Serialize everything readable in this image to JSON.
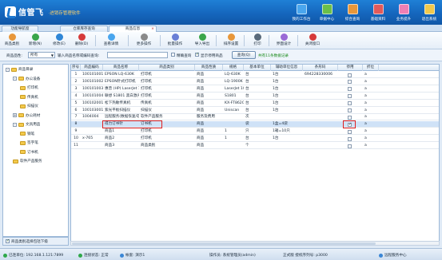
{
  "header": {
    "brand": "信管飞",
    "subtitle": "·进销存管理软件",
    "nav": [
      {
        "label": "我的工作台",
        "icon": "monitor-icon",
        "color": "#4aa6ee"
      },
      {
        "label": "单据中心",
        "icon": "document-icon",
        "color": "#6bbf4a"
      },
      {
        "label": "综合查询",
        "icon": "search-icon",
        "color": "#e8973a"
      },
      {
        "label": "基础资料",
        "icon": "database-icon",
        "color": "#e25a5a"
      },
      {
        "label": "业务提升",
        "icon": "chart-icon",
        "color": "#ef7fb4"
      },
      {
        "label": "退出系统",
        "icon": "exit-icon",
        "color": "#f2c94c"
      }
    ]
  },
  "tabs": [
    {
      "label": "功能导航窗"
    },
    {
      "label": "仓库库存查询"
    },
    {
      "label": "商品信息",
      "active": true
    }
  ],
  "toolbar": [
    {
      "label": "商品类别",
      "icon": "category-icon",
      "color": "#e8973a"
    },
    {
      "label": "新增(N)",
      "icon": "add-icon",
      "color": "#3aa64a"
    },
    {
      "label": "修改(E)",
      "icon": "edit-icon",
      "color": "#2f86d6"
    },
    {
      "label": "删除(D)",
      "icon": "delete-icon",
      "color": "#d63a3a"
    },
    {
      "label": "查看详情",
      "icon": "view-icon",
      "color": "#4aa6ee"
    },
    {
      "label": "更多操作",
      "icon": "more-icon",
      "color": "#8a8a8a"
    },
    {
      "label": "批量操作",
      "icon": "batch-icon",
      "color": "#6a7fd6"
    },
    {
      "label": "导入导出",
      "icon": "import-export-icon",
      "color": "#3aa64a"
    },
    {
      "label": "排序设置",
      "icon": "sort-icon",
      "color": "#e8973a"
    },
    {
      "label": "打印",
      "icon": "print-icon",
      "color": "#5a6a7a"
    },
    {
      "label": "界面设计",
      "icon": "design-icon",
      "color": "#9a6ad6"
    },
    {
      "label": "关闭窗口",
      "icon": "close-window-icon",
      "color": "#d63a3a"
    }
  ],
  "filter": {
    "type_label": "商品品性:",
    "type_value": "所有",
    "search_label": "输入商品名称或编码查询:",
    "opt_precise": "精确查询",
    "opt_show_disabled": "显示停用商品",
    "query_button": "查询(Q)",
    "count_text": "共有11条数据记录"
  },
  "tree": [
    {
      "label": "商品目录",
      "level": 0,
      "expander": "-"
    },
    {
      "label": "办公设备",
      "level": 1,
      "expander": "-"
    },
    {
      "label": "打印机",
      "level": 2
    },
    {
      "label": "传真机",
      "level": 2
    },
    {
      "label": "扫描仪",
      "level": 2
    },
    {
      "label": "办公耗材",
      "level": 1,
      "expander": "+"
    },
    {
      "label": "文具用品",
      "level": 1,
      "expander": "-"
    },
    {
      "label": "钢笔",
      "level": 2
    },
    {
      "label": "签字笔",
      "level": 2
    },
    {
      "label": "订书机",
      "level": 2
    },
    {
      "label": "软件产品服务",
      "level": 1
    }
  ],
  "tree_footer": "商品类别选择包括下级",
  "grid": {
    "columns": [
      "序号",
      "商品编码",
      "商品名称",
      "商品类别",
      "商品性质",
      "规格",
      "基本单位",
      "辅助单位信息",
      "条形码",
      "停用",
      "折位"
    ],
    "rows": [
      {
        "no": "1",
        "code": "100101001",
        "name": "EPSON LQ-630K",
        "cat": "打印机",
        "nature": "商品",
        "spec": "LQ-630K",
        "unit": "台",
        "aux": "1台",
        "barcode": "694228330006",
        "off": false,
        "sort": "a"
      },
      {
        "no": "2",
        "code": "100101002",
        "name": "EPSON针式打印机",
        "cat": "打印机",
        "nature": "商品",
        "spec": "LQ-1900K",
        "unit": "台",
        "aux": "1台",
        "barcode": "",
        "off": false,
        "sort": "a"
      },
      {
        "no": "3",
        "code": "100101003",
        "name": "惠普 (HP) LaserJet 1020",
        "cat": "打印机",
        "nature": "商品",
        "spec": "LaserJet 1020",
        "unit": "台",
        "aux": "1台",
        "barcode": "",
        "off": false,
        "sort": "a"
      },
      {
        "no": "4",
        "code": "100101004",
        "name": "联想 S1801 黑白激光打印机",
        "cat": "打印机",
        "nature": "商品",
        "spec": "S1801",
        "unit": "台",
        "aux": "1台",
        "barcode": "",
        "off": false,
        "sort": "a"
      },
      {
        "no": "5",
        "code": "100102001",
        "name": "松下热敏传真机",
        "cat": "传真机",
        "nature": "商品",
        "spec": "KX-FT862CN",
        "unit": "台",
        "aux": "1台",
        "barcode": "",
        "off": false,
        "sort": "a"
      },
      {
        "no": "6",
        "code": "100103001",
        "name": "紫光平板扫描仪",
        "cat": "扫描仪",
        "nature": "商品",
        "spec": "Uniscan",
        "unit": "台",
        "aux": "1台",
        "barcode": "",
        "off": false,
        "sort": "a"
      },
      {
        "no": "7",
        "code": "1004004",
        "name": "远程服务(数据恢复/软件安装)",
        "cat": "软件产品服务",
        "nature": "服务及费用",
        "spec": "",
        "unit": "次",
        "aux": "",
        "barcode": "",
        "off": false,
        "sort": "a"
      },
      {
        "no": "8",
        "code": "",
        "name": "得力订书针",
        "cat": "订书机",
        "nature": "商品",
        "spec": "",
        "unit": "袋",
        "aux": "1盒=4袋",
        "barcode": "",
        "off": true,
        "sort": "a",
        "selected": true
      },
      {
        "no": "9",
        "code": "",
        "name": "商品1",
        "cat": "打印机",
        "nature": "商品",
        "spec": "1",
        "unit": "只",
        "aux": "1箱=10只",
        "barcode": "",
        "off": false,
        "sort": "a"
      },
      {
        "no": "10",
        "code": "x-765",
        "name": "商品2",
        "cat": "打印机",
        "nature": "商品",
        "spec": "1",
        "unit": "台",
        "aux": "1台",
        "barcode": "",
        "off": false,
        "sort": "a"
      },
      {
        "no": "11",
        "code": "",
        "name": "商品3",
        "cat": "商品类别",
        "nature": "商品",
        "spec": "",
        "unit": "个",
        "aux": "",
        "barcode": "",
        "off": false,
        "sort": "a"
      }
    ]
  },
  "statusbar": {
    "server": "已连单位: 192.168.1.121:7899",
    "conn": "连接状态: 正常",
    "account": "帐套: 演示1",
    "operator": "操作员: 系统管理员(admin)",
    "edition": "正式版  授权序列号: p3000",
    "support": "远程服务中心"
  }
}
